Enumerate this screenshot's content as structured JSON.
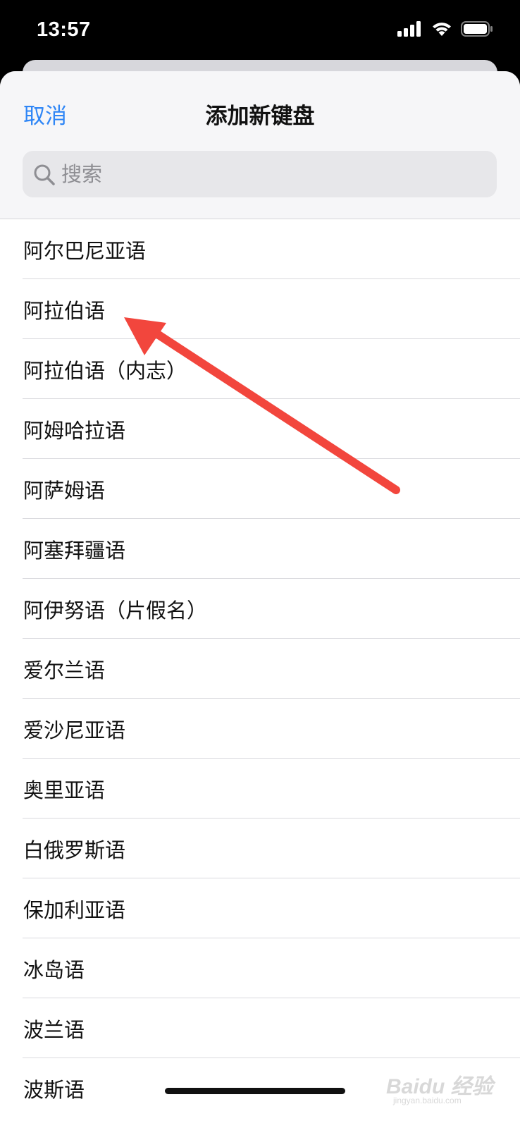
{
  "status_bar": {
    "time": "13:57",
    "icons": [
      "cellular-signal-icon",
      "wifi-icon",
      "battery-icon"
    ]
  },
  "sheet": {
    "cancel_label": "取消",
    "title": "添加新键盘",
    "search": {
      "placeholder": "搜索",
      "value": ""
    },
    "languages": [
      "阿尔巴尼亚语",
      "阿拉伯语",
      "阿拉伯语（内志）",
      "阿姆哈拉语",
      "阿萨姆语",
      "阿塞拜疆语",
      "阿伊努语（片假名）",
      "爱尔兰语",
      "爱沙尼亚语",
      "奥里亚语",
      "白俄罗斯语",
      "保加利亚语",
      "冰岛语",
      "波兰语",
      "波斯语"
    ]
  },
  "annotation": {
    "color": "#f2463d",
    "target": "阿拉伯语"
  },
  "watermark": {
    "text": "Baidu 经验",
    "sub": "jingyan.baidu.com"
  },
  "colors": {
    "accent": "#2f86f6",
    "sheet_header_bg": "#f6f6f8",
    "search_bg": "#e7e7ea",
    "separator": "#dadade"
  }
}
